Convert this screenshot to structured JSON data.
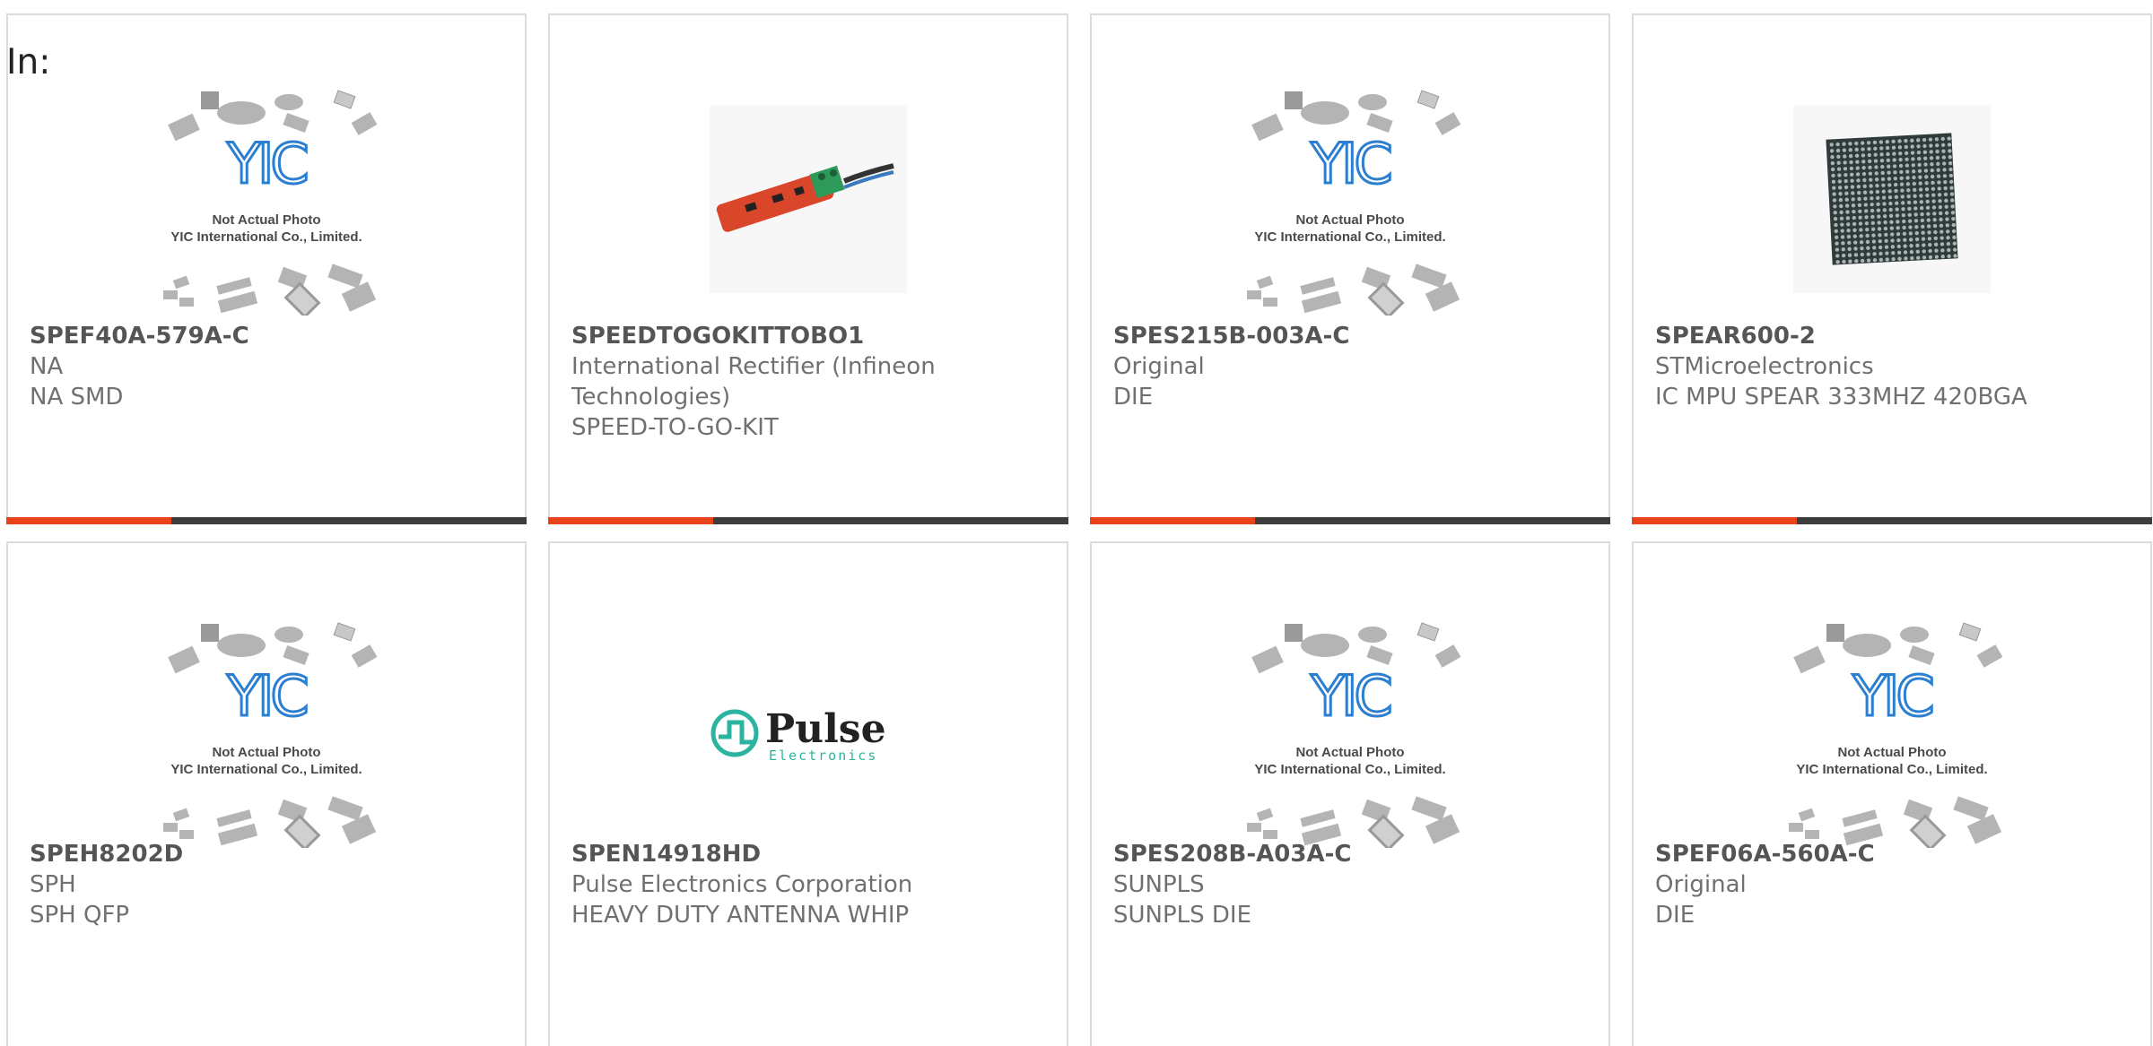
{
  "filter_label": "In:",
  "placeholder_caption": {
    "line1": "Not Actual Photo",
    "line2": "YIC International Co., Limited.",
    "logo": "YIC"
  },
  "pulse_logo": {
    "word": "Pulse",
    "sub": "Electronics"
  },
  "colors": {
    "accent": "#e8421a",
    "bar": "#3d3d3d",
    "border": "#dcdcdc",
    "yic_blue": "#2c7fd0",
    "pulse_teal": "#2bb5a0"
  },
  "products": [
    {
      "part": "SPEF40A-579A-C",
      "manufacturer": "NA",
      "description": "NA SMD",
      "image": "yic-placeholder"
    },
    {
      "part": "SPEEDTOGOKITTOBO1",
      "manufacturer": "International Rectifier (Infineon Technologies)",
      "description": "SPEED-TO-GO-KIT",
      "image": "dev-board-photo"
    },
    {
      "part": "SPES215B-003A-C",
      "manufacturer": "Original",
      "description": "DIE",
      "image": "yic-placeholder"
    },
    {
      "part": "SPEAR600-2",
      "manufacturer": "STMicroelectronics",
      "description": "IC MPU SPEAR 333MHZ 420BGA",
      "image": "bga-chip-photo"
    },
    {
      "part": "SPEH8202D",
      "manufacturer": "SPH",
      "description": "SPH QFP",
      "image": "yic-placeholder"
    },
    {
      "part": "SPEN14918HD",
      "manufacturer": "Pulse Electronics Corporation",
      "description": "HEAVY DUTY ANTENNA WHIP",
      "image": "pulse-logo"
    },
    {
      "part": "SPES208B-A03A-C",
      "manufacturer": "SUNPLS",
      "description": "SUNPLS DIE",
      "image": "yic-placeholder"
    },
    {
      "part": "SPEF06A-560A-C",
      "manufacturer": "Original",
      "description": "DIE",
      "image": "yic-placeholder"
    }
  ]
}
